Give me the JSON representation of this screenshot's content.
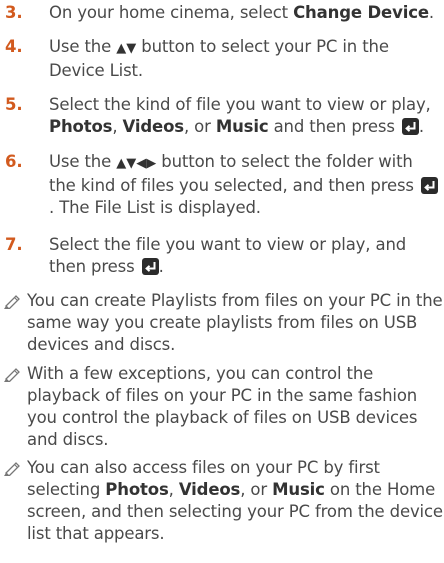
{
  "steps": [
    {
      "number": "3.",
      "text_1": "On your home cinema, select ",
      "kw_1": "Change Device",
      "text_2": "."
    },
    {
      "number": "4.",
      "text_1": "Use the ",
      "arrows": "▲▼",
      "text_2": " button to select your PC in the Device List."
    },
    {
      "number": "5.",
      "text_1": "Select the kind of file you want to view or play, ",
      "kw_1": "Photos",
      "text_2": ", ",
      "kw_2": "Videos",
      "text_3": ", or ",
      "kw_3": "Music",
      "text_4": " and then press ",
      "text_5": "."
    },
    {
      "number": "6.",
      "text_1": "Use the ",
      "arrows": "▲▼◀▶",
      "text_2": " button to select the folder with the kind of files you selected, and then press ",
      "text_3": ". The File List is displayed."
    },
    {
      "number": "7.",
      "text_1": "Select the file you want to view or play, and then press ",
      "text_2": "."
    }
  ],
  "notes": [
    {
      "icon": "note-pencil-icon",
      "text": "You can create Playlists from files on your PC in the same way you create playlists from files on USB devices and discs."
    },
    {
      "icon": "note-pencil-icon",
      "text": "With a few exceptions, you can control the playback of files on your PC in the same fashion you control the playback of files on USB devices and discs."
    },
    {
      "icon": "note-pencil-icon",
      "text_1": "You can also access files on your PC by first selecting ",
      "kw_1": "Photos",
      "text_2": ", ",
      "kw_2": "Videos",
      "text_3": ", or ",
      "kw_3": "Music",
      "text_4": " on the Home screen, and then selecting your PC from the device list that appears."
    }
  ],
  "colors": {
    "step_number": "#d25a1e",
    "body_text": "#4a4a4a",
    "keyword": "#333333",
    "enter_button_bg": "#2b2b2b",
    "note_icon": "#777777"
  },
  "icons": {
    "enter_button": "enter-button-icon"
  }
}
